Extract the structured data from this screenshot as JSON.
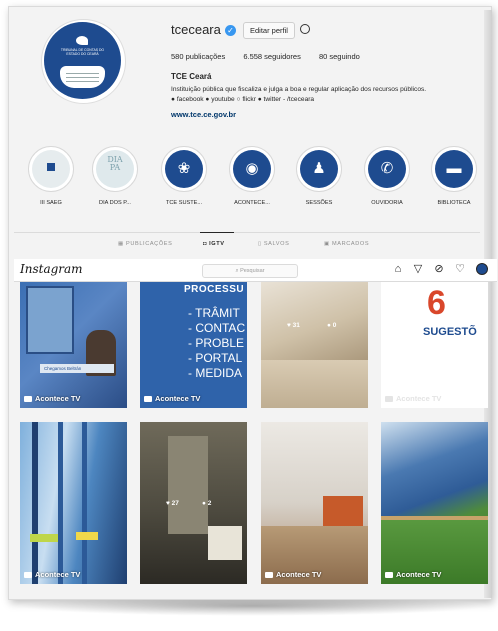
{
  "profile": {
    "username": "tceceara",
    "edit_profile_label": "Editar perfil",
    "posts_label": "580 publicações",
    "followers_label": "6.558 seguidores",
    "following_label": "80 seguindo",
    "display_name": "TCE Ceará",
    "bio_line1": "Instituição pública que fiscaliza e julga a boa e regular aplicação dos recursos públicos.",
    "bio_line2": "● facebook ● youtube ○ flickr ● twitter - /tceceara",
    "website": "www.tce.ce.gov.br",
    "avatar_text": "TRIBUNAL DE CONTAS DO ESTADO DO CEARÁ"
  },
  "highlights": [
    {
      "label": "III SAEG",
      "icon": "square-icon"
    },
    {
      "label": "DIA DOS P...",
      "icon": "text-icon"
    },
    {
      "label": "TCE SUSTE...",
      "icon": "leaf-icon"
    },
    {
      "label": "ACONTECE...",
      "icon": "tv-icon"
    },
    {
      "label": "SESSÕES",
      "icon": "people-icon"
    },
    {
      "label": "OUVIDORIA",
      "icon": "chat-icon"
    },
    {
      "label": "BIBLIOTECA",
      "icon": "book-icon"
    }
  ],
  "tabs": [
    {
      "label": "PUBLICAÇÕES",
      "active": false
    },
    {
      "label": "IGTV",
      "active": true
    },
    {
      "label": "SALVOS",
      "active": false
    },
    {
      "label": "MARCADOS",
      "active": false
    }
  ],
  "topbar": {
    "logo": "Instagram",
    "search_placeholder": "Pesquisar"
  },
  "tiles": [
    {
      "caption": "Acontece TV",
      "banner": "Chegamos Beltrán"
    },
    {
      "caption": "Acontece TV",
      "text_lines": [
        "PROCESSU",
        "- TRÂMIT",
        "- CONTAC",
        "- PROBLE",
        "- PORTAL",
        "- MEDIDA"
      ]
    },
    {
      "likes": "31",
      "comments": "0"
    },
    {
      "caption": "Acontece TV",
      "number": "6",
      "word": "SUGESTÕ"
    },
    {
      "caption": "Acontece TV"
    },
    {
      "likes": "27",
      "comments": "2"
    },
    {
      "caption": "Acontece TV"
    },
    {
      "caption": "Acontece TV"
    }
  ],
  "colors": {
    "brand_blue": "#1e4b8f",
    "link": "#00376b",
    "verified": "#3897f0"
  }
}
